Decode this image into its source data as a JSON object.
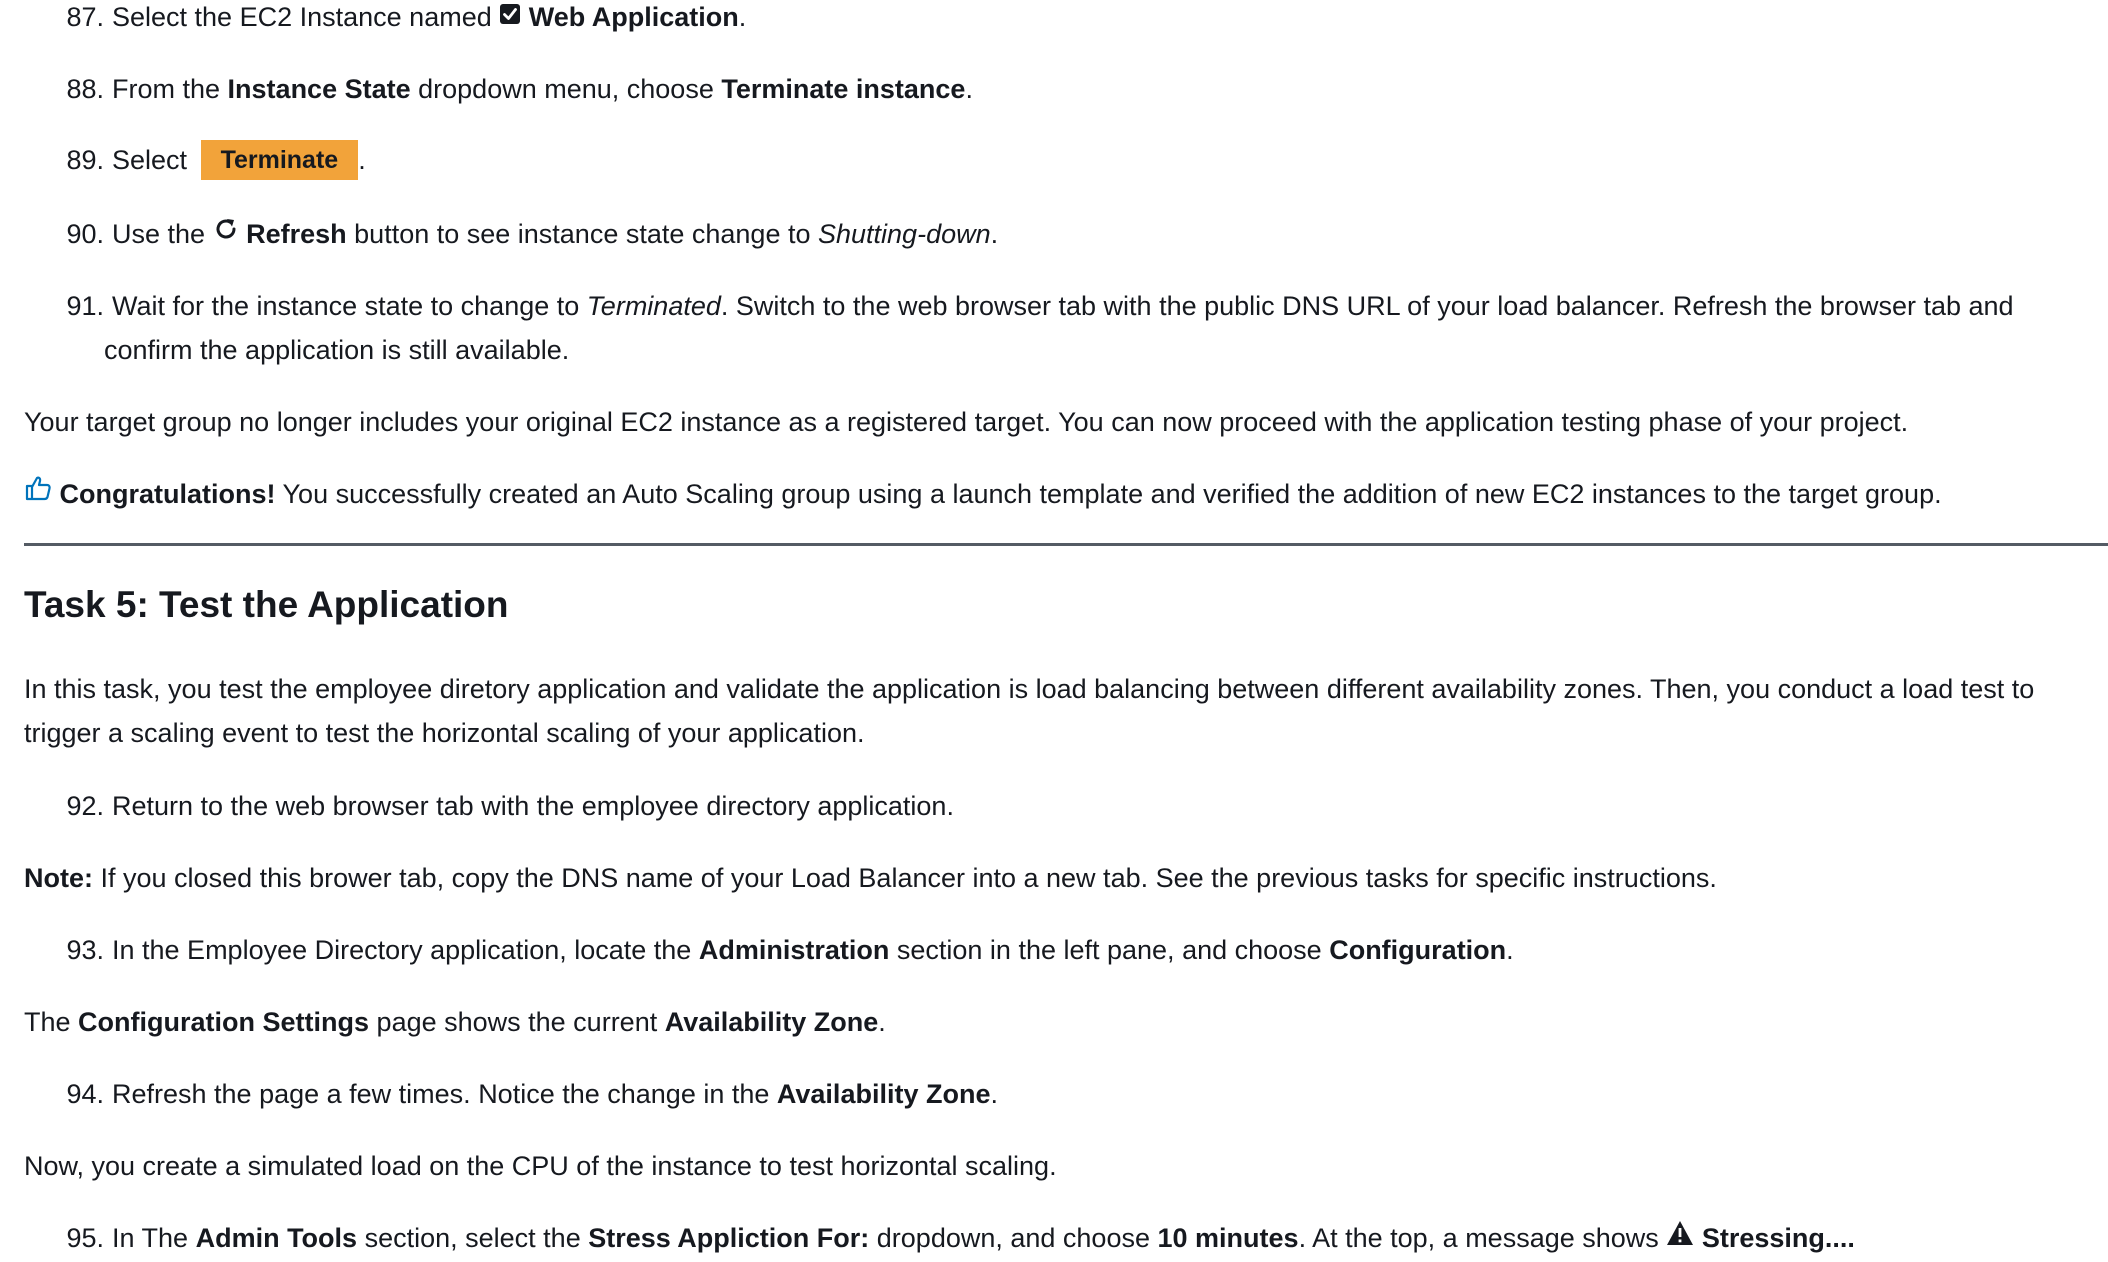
{
  "steps": {
    "s87": {
      "num": "87.",
      "text_before": "Select the EC2 Instance named",
      "bold": "Web Application",
      "text_after": "."
    },
    "s88": {
      "num": "88.",
      "text1": "From the",
      "bold1": "Instance State",
      "text2": "dropdown menu, choose",
      "bold2": "Terminate instance",
      "text3": "."
    },
    "s89": {
      "num": "89.",
      "text1": "Select",
      "button_label": "Terminate",
      "text2": "."
    },
    "s90": {
      "num": "90.",
      "text1": "Use the",
      "bold1": "Refresh",
      "text2": "button to see instance state change to",
      "italic1": "Shutting-down",
      "text3": "."
    },
    "s91": {
      "num": "91.",
      "text1": "Wait for the instance state to change to",
      "italic1": "Terminated",
      "text2": ". Switch to the web browser tab with the public DNS URL of your load balancer. Refresh the browser tab and confirm the application is still available."
    },
    "s92": {
      "num": "92.",
      "text1": "Return to the web browser tab with the employee directory application."
    },
    "s93": {
      "num": "93.",
      "text1": "In the Employee Directory application, locate the",
      "bold1": "Administration",
      "text2": "section in the left pane, and choose",
      "bold2": "Configuration",
      "text3": "."
    },
    "s94": {
      "num": "94.",
      "text1": "Refresh the page a few times. Notice the change in the",
      "bold1": "Availability Zone",
      "text2": "."
    },
    "s95": {
      "num": "95.",
      "text1": "In The",
      "bold1": "Admin Tools",
      "text2": "section, select the",
      "bold2": "Stress Appliction For:",
      "text3": "dropdown, and choose",
      "bold3": "10 minutes",
      "text4": ". At the top, a message shows",
      "bold4": "Stressing....",
      "text5": ""
    }
  },
  "paragraphs": {
    "target_group": "Your target group no longer includes your original EC2 instance as a registered target. You can now proceed with the application testing phase of your project.",
    "congrats_bold": "Congratulations!",
    "congrats_text": "You successfully created an Auto Scaling group using a launch template and verified the addition of new EC2 instances to the target group.",
    "task_intro": "In this task, you test the employee diretory application and validate the application is load balancing between different availability zones. Then, you conduct a load test to trigger a scaling event to test the horizontal scaling of your application.",
    "note_bold": "Note:",
    "note_text": "If you closed this brower tab, copy the DNS name of your Load Balancer into a new tab. See the previous tasks for specific instructions.",
    "config_text1": "The",
    "config_bold1": "Configuration Settings",
    "config_text2": "page shows the current",
    "config_bold2": "Availability Zone",
    "config_text3": ".",
    "simulated_load": "Now, you create a simulated load on the CPU of the instance to test horizontal scaling."
  },
  "heading": {
    "task5": "Task 5: Test the Application"
  },
  "colors": {
    "terminate_button_bg": "#f2a33a",
    "thumbs_up_icon": "#0073bb",
    "divider": "#545b64",
    "text": "#16191f"
  },
  "icons": {
    "checkbox": "checkbox-checked-icon",
    "refresh": "refresh-icon",
    "thumbs_up": "thumbs-up-icon",
    "warning": "warning-icon"
  }
}
